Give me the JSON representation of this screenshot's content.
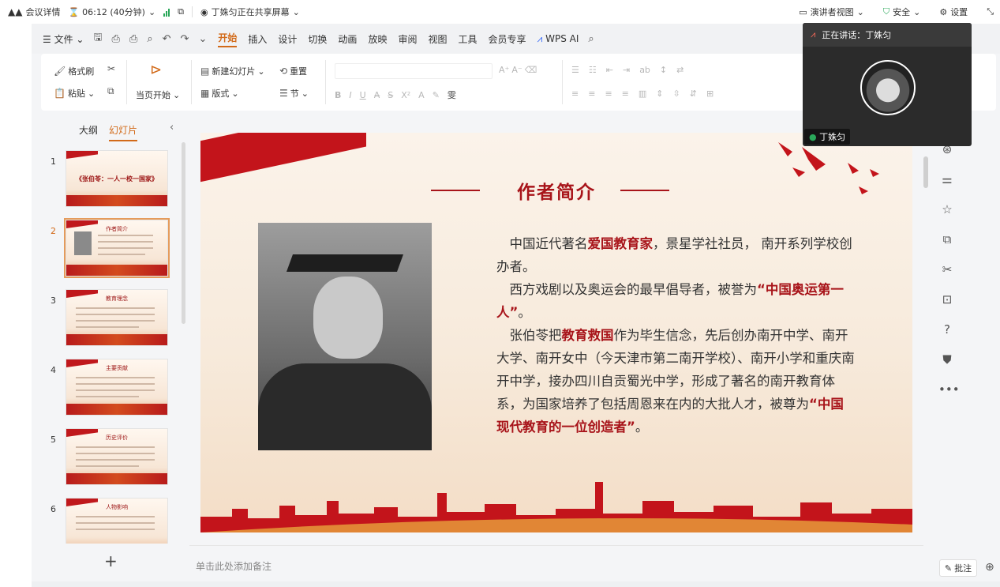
{
  "meeting_bar": {
    "details": "会议详情",
    "timer": "06:12 (40分钟)",
    "sharing": "丁姝匀正在共享屏幕",
    "presenter_view": "演讲者视图",
    "security": "安全",
    "settings": "设置"
  },
  "menu": {
    "file": "文件",
    "tabs": [
      "开始",
      "插入",
      "设计",
      "切换",
      "动画",
      "放映",
      "审阅",
      "视图",
      "工具",
      "会员专享"
    ],
    "ai": "WPS AI"
  },
  "ribbon": {
    "format_painter": "格式刷",
    "paste": "粘贴",
    "play_current": "当页开始",
    "new_slide": "新建幻灯片",
    "reset": "重置",
    "layout": "版式",
    "section": "节"
  },
  "left_panel": {
    "tab_outline": "大纲",
    "tab_slides": "幻灯片",
    "thumbnails": [
      {
        "num": "1",
        "title": "《张伯苓：一人一校一国家》"
      },
      {
        "num": "2",
        "title": "作者简介"
      },
      {
        "num": "3",
        "title": "教育理念"
      },
      {
        "num": "4",
        "title": "主要贡献"
      },
      {
        "num": "5",
        "title": "历史评价"
      },
      {
        "num": "6",
        "title": "人物影响"
      }
    ],
    "add": "+"
  },
  "slide": {
    "title": "作者简介",
    "p1_a": "中国近代著名",
    "p1_b": "爱国教育家",
    "p1_c": "，景星学社社员， 南开系列学校创办者。",
    "p2_a": "西方戏剧以及奥运会的最早倡导者，被誉为",
    "p2_b": "“中国奥运第一人”",
    "p2_c": "。",
    "p3_a": "张伯苓把",
    "p3_b": "教育救国",
    "p3_c": "作为毕生信念，先后创办南开中学、南开大学、南开女中（今天津市第二南开学校）、南开小学和重庆南开中学，接办四川自贡蜀光中学，形成了著名的南开教育体系，为国家培养了包括周恩来在内的大批人才，被尊为",
    "p3_d": "“中国现代教育的一位创造者”",
    "p3_e": "。"
  },
  "notes_placeholder": "单击此处添加备注",
  "comment_button": "批注",
  "video": {
    "speaking": "正在讲话：丁姝匀",
    "name": "丁姝匀"
  }
}
